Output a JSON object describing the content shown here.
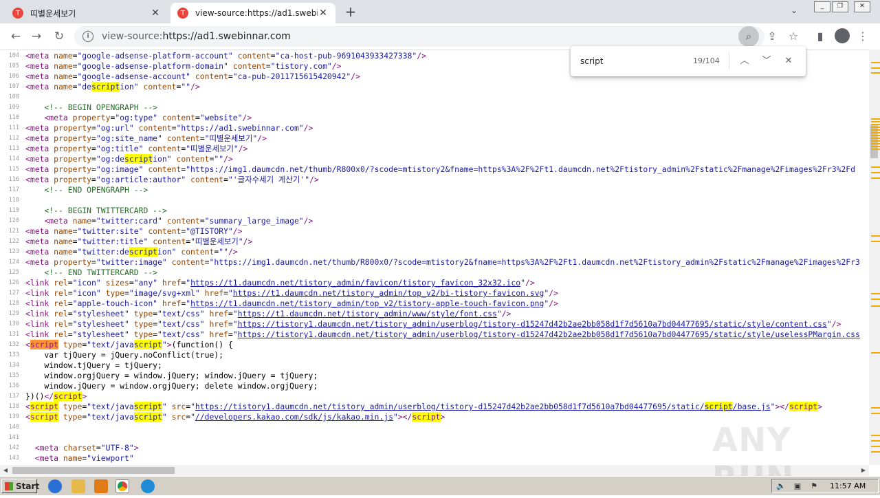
{
  "tabs": [
    {
      "title": "띠별운세보기",
      "favicon": "T",
      "active": false
    },
    {
      "title": "view-source:https://ad1.swebinnar.com",
      "favicon": "T",
      "active": true
    }
  ],
  "address_bar": {
    "prefix": "view-source:",
    "url": "https://ad1.swebinnar.com"
  },
  "find_bar": {
    "query": "script",
    "count": "19/104"
  },
  "source_lines": [
    {
      "n": "104",
      "html": "<span class=\"tg\">&lt;meta</span> <span class=\"at\">name</span>=<span class=\"av\">\"google-adsense-platform-account\"</span> <span class=\"at\">content</span>=<span class=\"av\">\"ca-host-pub-9691043933427338\"</span><span class=\"tg\">/&gt;</span>"
    },
    {
      "n": "105",
      "html": "<span class=\"tg\">&lt;meta</span> <span class=\"at\">name</span>=<span class=\"av\">\"google-adsense-platform-domain\"</span> <span class=\"at\">content</span>=<span class=\"av\">\"tistory.com\"</span><span class=\"tg\">/&gt;</span>"
    },
    {
      "n": "106",
      "html": "<span class=\"tg\">&lt;meta</span> <span class=\"at\">name</span>=<span class=\"av\">\"google-adsense-account\"</span> <span class=\"at\">content</span>=<span class=\"av\">\"ca-pub-2011715615420942\"</span><span class=\"tg\">/&gt;</span>"
    },
    {
      "n": "107",
      "html": "<span class=\"tg\">&lt;meta</span> <span class=\"at\">name</span>=<span class=\"av\">\"de<span class=\"hl\">script</span>ion\"</span> <span class=\"at\">content</span>=<span class=\"av\">\"\"</span><span class=\"tg\">/&gt;</span>"
    },
    {
      "n": "108",
      "html": ""
    },
    {
      "n": "109",
      "html": "    <span class=\"cm\">&lt;!-- BEGIN OPENGRAPH --&gt;</span>"
    },
    {
      "n": "110",
      "html": "    <span class=\"tg\">&lt;meta</span> <span class=\"at\">property</span>=<span class=\"av\">\"og:type\"</span> <span class=\"at\">content</span>=<span class=\"av\">\"website\"</span><span class=\"tg\">/&gt;</span>"
    },
    {
      "n": "111",
      "html": "<span class=\"tg\">&lt;meta</span> <span class=\"at\">property</span>=<span class=\"av\">\"og:url\"</span> <span class=\"at\">content</span>=<span class=\"av\">\"https://ad1.swebinnar.com\"</span><span class=\"tg\">/&gt;</span>"
    },
    {
      "n": "112",
      "html": "<span class=\"tg\">&lt;meta</span> <span class=\"at\">property</span>=<span class=\"av\">\"og:site_name\"</span> <span class=\"at\">content</span>=<span class=\"av\">\"띠별운세보기\"</span><span class=\"tg\">/&gt;</span>"
    },
    {
      "n": "113",
      "html": "<span class=\"tg\">&lt;meta</span> <span class=\"at\">property</span>=<span class=\"av\">\"og:title\"</span> <span class=\"at\">content</span>=<span class=\"av\">\"띠별운세보기\"</span><span class=\"tg\">/&gt;</span>"
    },
    {
      "n": "114",
      "html": "<span class=\"tg\">&lt;meta</span> <span class=\"at\">property</span>=<span class=\"av\">\"og:de<span class=\"hl\">script</span>ion\"</span> <span class=\"at\">content</span>=<span class=\"av\">\"\"</span><span class=\"tg\">/&gt;</span>"
    },
    {
      "n": "115",
      "html": "<span class=\"tg\">&lt;meta</span> <span class=\"at\">property</span>=<span class=\"av\">\"og:image\"</span> <span class=\"at\">content</span>=<span class=\"av\">\"https://img1.daumcdn.net/thumb/R800x0/?scode=mtistory2&amp;fname=https%3A%2F%2Ft1.daumcdn.net%2Ftistory_admin%2Fstatic%2Fmanage%2Fimages%2Fr3%2Fd</span>"
    },
    {
      "n": "116",
      "html": "<span class=\"tg\">&lt;meta</span> <span class=\"at\">property</span>=<span class=\"av\">\"og:article:author\"</span> <span class=\"at\">content</span>=<span class=\"av\">\"'글자수세기 계산기'\"</span><span class=\"tg\">/&gt;</span>"
    },
    {
      "n": "117",
      "html": "    <span class=\"cm\">&lt;!-- END OPENGRAPH --&gt;</span>"
    },
    {
      "n": "118",
      "html": ""
    },
    {
      "n": "119",
      "html": "    <span class=\"cm\">&lt;!-- BEGIN TWITTERCARD --&gt;</span>"
    },
    {
      "n": "120",
      "html": "    <span class=\"tg\">&lt;meta</span> <span class=\"at\">name</span>=<span class=\"av\">\"twitter:card\"</span> <span class=\"at\">content</span>=<span class=\"av\">\"summary_large_image\"</span><span class=\"tg\">/&gt;</span>"
    },
    {
      "n": "121",
      "html": "<span class=\"tg\">&lt;meta</span> <span class=\"at\">name</span>=<span class=\"av\">\"twitter:site\"</span> <span class=\"at\">content</span>=<span class=\"av\">\"@TISTORY\"</span><span class=\"tg\">/&gt;</span>"
    },
    {
      "n": "122",
      "html": "<span class=\"tg\">&lt;meta</span> <span class=\"at\">name</span>=<span class=\"av\">\"twitter:title\"</span> <span class=\"at\">content</span>=<span class=\"av\">\"띠별운세보기\"</span><span class=\"tg\">/&gt;</span>"
    },
    {
      "n": "123",
      "html": "<span class=\"tg\">&lt;meta</span> <span class=\"at\">name</span>=<span class=\"av\">\"twitter:de<span class=\"hl\">script</span>ion\"</span> <span class=\"at\">content</span>=<span class=\"av\">\"\"</span><span class=\"tg\">/&gt;</span>"
    },
    {
      "n": "124",
      "html": "<span class=\"tg\">&lt;meta</span> <span class=\"at\">property</span>=<span class=\"av\">\"twitter:image\"</span> <span class=\"at\">content</span>=<span class=\"av\">\"https://img1.daumcdn.net/thumb/R800x0/?scode=mtistory2&amp;fname=https%3A%2F%2Ft1.daumcdn.net%2Ftistory_admin%2Fstatic%2Fmanage%2Fimages%2Fr3</span>"
    },
    {
      "n": "125",
      "html": "    <span class=\"cm\">&lt;!-- END TWITTERCARD --&gt;</span>"
    },
    {
      "n": "126",
      "html": "<span class=\"tg\">&lt;link</span> <span class=\"at\">rel</span>=<span class=\"av\">\"icon\"</span> <span class=\"at\">sizes</span>=<span class=\"av\">\"any\"</span> <span class=\"at\">href</span>=<span class=\"av\">\"<span class=\"lk\">https://t1.daumcdn.net/tistory_admin/favicon/tistory_favicon_32x32.ico</span>\"</span><span class=\"tg\">/&gt;</span>"
    },
    {
      "n": "127",
      "html": "<span class=\"tg\">&lt;link</span> <span class=\"at\">rel</span>=<span class=\"av\">\"icon\"</span> <span class=\"at\">type</span>=<span class=\"av\">\"image/svg+xml\"</span> <span class=\"at\">href</span>=<span class=\"av\">\"<span class=\"lk\">https://t1.daumcdn.net/tistory_admin/top_v2/bi-tistory-favicon.svg</span>\"</span><span class=\"tg\">/&gt;</span>"
    },
    {
      "n": "128",
      "html": "<span class=\"tg\">&lt;link</span> <span class=\"at\">rel</span>=<span class=\"av\">\"apple-touch-icon\"</span> <span class=\"at\">href</span>=<span class=\"av\">\"<span class=\"lk\">https://t1.daumcdn.net/tistory_admin/top_v2/tistory-apple-touch-favicon.png</span>\"</span><span class=\"tg\">/&gt;</span>"
    },
    {
      "n": "129",
      "html": "<span class=\"tg\">&lt;link</span> <span class=\"at\">rel</span>=<span class=\"av\">\"stylesheet\"</span> <span class=\"at\">type</span>=<span class=\"av\">\"text/css\"</span> <span class=\"at\">href</span>=<span class=\"av\">\"<span class=\"lk\">https://t1.daumcdn.net/tistory_admin/www/style/font.css</span>\"</span><span class=\"tg\">/&gt;</span>"
    },
    {
      "n": "130",
      "html": "<span class=\"tg\">&lt;link</span> <span class=\"at\">rel</span>=<span class=\"av\">\"stylesheet\"</span> <span class=\"at\">type</span>=<span class=\"av\">\"text/css\"</span> <span class=\"at\">href</span>=<span class=\"av\">\"<span class=\"lk\">https://tistory1.daumcdn.net/tistory_admin/userblog/tistory-d15247d42b2ae2bb058d1f7d5610a7bd04477695/static/style/content.css</span>\"</span><span class=\"tg\">/&gt;</span>"
    },
    {
      "n": "131",
      "html": "<span class=\"tg\">&lt;link</span> <span class=\"at\">rel</span>=<span class=\"av\">\"stylesheet\"</span> <span class=\"at\">type</span>=<span class=\"av\">\"text/css\"</span> <span class=\"at\">href</span>=<span class=\"av\">\"<span class=\"lk\">https://tistory1.daumcdn.net/tistory_admin/userblog/tistory-d15247d42b2ae2bb058d1f7d5610a7bd04477695/static/style/uselessPMargin.css</span></span>"
    },
    {
      "n": "132",
      "html": "<span class=\"tg\">&lt;<span class=\"hl-cur\">script</span></span> <span class=\"at\">type</span>=<span class=\"av\">\"text/java<span class=\"hl\">script</span>\"</span><span class=\"tg\">&gt;</span>(function() {"
    },
    {
      "n": "133",
      "html": "    var tjQuery = jQuery.noConflict(true);"
    },
    {
      "n": "134",
      "html": "    window.tjQuery = tjQuery;"
    },
    {
      "n": "135",
      "html": "    window.orgjQuery = window.jQuery; window.jQuery = tjQuery;"
    },
    {
      "n": "136",
      "html": "    window.jQuery = window.orgjQuery; delete window.orgjQuery;"
    },
    {
      "n": "137",
      "html": "})()<span class=\"tg\">&lt;/<span class=\"hl\">script</span>&gt;</span>"
    },
    {
      "n": "138",
      "html": "<span class=\"tg\">&lt;<span class=\"hl\">script</span></span> <span class=\"at\">type</span>=<span class=\"av\">\"text/java<span class=\"hl\">script</span>\"</span> <span class=\"at\">src</span>=<span class=\"av\">\"<span class=\"lk\">https://tistory1.daumcdn.net/tistory_admin/userblog/tistory-d15247d42b2ae2bb058d1f7d5610a7bd04477695/static/<span class=\"hl\">script</span>/base.js</span>\"</span><span class=\"tg\">&gt;&lt;/<span class=\"hl\">script</span>&gt;</span>"
    },
    {
      "n": "139",
      "html": "<span class=\"tg\">&lt;<span class=\"hl\">script</span></span> <span class=\"at\">type</span>=<span class=\"av\">\"text/java<span class=\"hl\">script</span>\"</span> <span class=\"at\">src</span>=<span class=\"av\">\"<span class=\"lk\">//developers.kakao.com/sdk/js/kakao.min.js</span>\"</span><span class=\"tg\">&gt;&lt;/<span class=\"hl\">script</span>&gt;</span>"
    },
    {
      "n": "140",
      "html": ""
    },
    {
      "n": "141",
      "html": ""
    },
    {
      "n": "142",
      "html": "  <span class=\"tg\">&lt;meta</span> <span class=\"at\">charset</span>=<span class=\"av\">\"UTF-8\"</span><span class=\"tg\">&gt;</span>"
    },
    {
      "n": "143",
      "html": "  <span class=\"tg\">&lt;meta</span> <span class=\"at\">name</span>=<span class=\"av\">\"viewport\"</span>"
    }
  ],
  "taskbar": {
    "start_label": "Start",
    "clock": "11:57 AM"
  },
  "watermark": "ANY RUN",
  "colors": {
    "tab_strip": "#dee1e6",
    "highlight": "#ffff00",
    "current_match": "#ff9632",
    "taskbar": "#d4d0c8"
  }
}
